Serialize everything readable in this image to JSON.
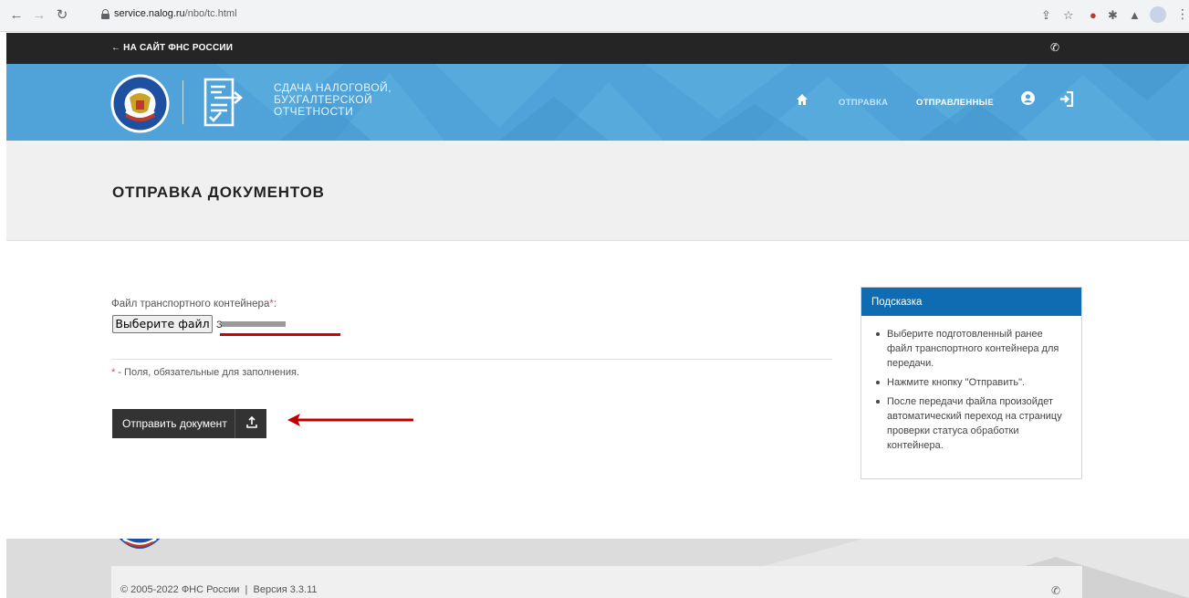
{
  "browser": {
    "url_host": "service.nalog.ru",
    "url_path": "/nbo/tc.html"
  },
  "topbar": {
    "back_link": "← НА САЙТ ФНС РОССИИ"
  },
  "header": {
    "title_line1": "СДАЧА НАЛОГОВОЙ,",
    "title_line2": "БУХГАЛТЕРСКОЙ",
    "title_line3": "ОТЧЕТНОСТИ",
    "menu_send": "ОТПРАВКА",
    "menu_sent": "ОТПРАВЛЕННЫЕ",
    "accent_color": "#4fa3d8",
    "active_menu_color": "#bfe6ff"
  },
  "page": {
    "title": "ОТПРАВКА ДОКУМЕНТОВ"
  },
  "form": {
    "file_label": "Файл транспортного контейнера",
    "required_mark": "*",
    "file_label_suffix": ":",
    "file_button": "Выберите файл",
    "file_name_first_char": "З",
    "required_note_star": "*",
    "required_note": " - Поля, обязательные для заполнения.",
    "submit_button": "Отправить документ"
  },
  "hint": {
    "title": "Подсказка",
    "items": [
      "Выберите подготовленный ранее файл транспортного контейнера для передачи.",
      "Нажмите кнопку \"Отправить\".",
      "После передачи файла произойдет автоматический переход на страницу проверки статуса обработки контейнера."
    ]
  },
  "footer": {
    "copyright": "© 2005-2022 ФНС России",
    "divider": "|",
    "version": "Версия 3.3.11"
  }
}
